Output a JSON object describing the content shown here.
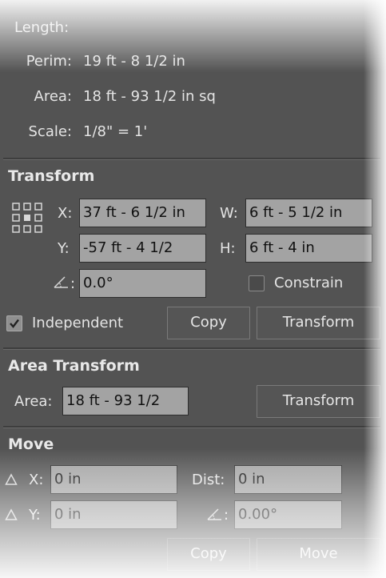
{
  "measure": {
    "length_label": "Length:",
    "perim_label": "Perim:",
    "perim_value": "19 ft - 8 1/2 in",
    "area_label": "Area:",
    "area_value": "18 ft - 93 1/2 in sq",
    "scale_label": "Scale:",
    "scale_value": "1/8\" = 1'"
  },
  "transform": {
    "title": "Transform",
    "x_label": "X:",
    "x_value": "37 ft - 6 1/2 in",
    "y_label": "Y:",
    "y_value": "-57 ft - 4 1/2",
    "w_label": "W:",
    "w_value": "6 ft - 5 1/2 in",
    "h_label": "H:",
    "h_value": "6 ft - 4 in",
    "angle_suffix": ":",
    "angle_value": "0.0°",
    "constrain_label": "Constrain",
    "constrain_checked": false,
    "independent_label": "Independent",
    "independent_checked": true,
    "copy_label": "Copy",
    "transform_label": "Transform"
  },
  "area_transform": {
    "title": "Area Transform",
    "area_label": "Area:",
    "area_value": "18 ft - 93 1/2",
    "transform_label": "Transform"
  },
  "move": {
    "title": "Move",
    "x_label": "X:",
    "x_value": "0 in",
    "y_label": "Y:",
    "y_value": "0 in",
    "dist_label": "Dist:",
    "dist_value": "0 in",
    "angle_suffix": ":",
    "angle_value": "0.00°",
    "copy_label": "Copy",
    "move_label": "Move"
  },
  "colors": {
    "panel_bg": "#535353",
    "field_bg": "#a3a3a3",
    "text": "#e4e4e4"
  }
}
